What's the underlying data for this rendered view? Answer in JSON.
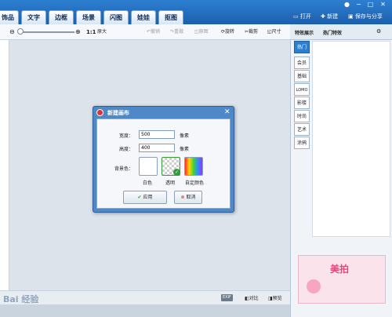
{
  "nav": {
    "tabs": [
      "饰品",
      "文字",
      "边框",
      "场景",
      "闪图",
      "娃娃",
      "抠图"
    ],
    "open": "打开",
    "new": "新建",
    "save_share": "保存与分享"
  },
  "toolbar": {
    "zoom_ratio": "1:1",
    "original": "原大",
    "undo": "撤销",
    "redo": "重做",
    "original_image": "原图",
    "rotate": "旋转",
    "crop": "裁剪",
    "size": "尺寸"
  },
  "right_panel": {
    "tabs": [
      "特效展示",
      "热门特效"
    ],
    "categories": [
      "热门",
      "会员",
      "基础",
      "LOMO",
      "影楼",
      "时尚",
      "艺术",
      "涂鸦"
    ],
    "promo_brand": "美拍"
  },
  "bottom": {
    "exif": "EXIF",
    "compare": "对比",
    "preview": "预览",
    "watermark": "Bai 经验"
  },
  "dialog": {
    "title": "新建画布",
    "width_label": "宽度：",
    "width_value": "500",
    "height_label": "高度：",
    "height_value": "400",
    "unit": "像素",
    "background_label": "背景色：",
    "swatches": [
      "白色",
      "透明",
      "自定颜色"
    ],
    "apply": "应用",
    "cancel": "取消"
  },
  "colors": {
    "nav_blue": "#1c5fae",
    "active_blue": "#2b7fd2",
    "apply_green": "#2e9d3a",
    "cancel_red": "#d23a2c"
  }
}
